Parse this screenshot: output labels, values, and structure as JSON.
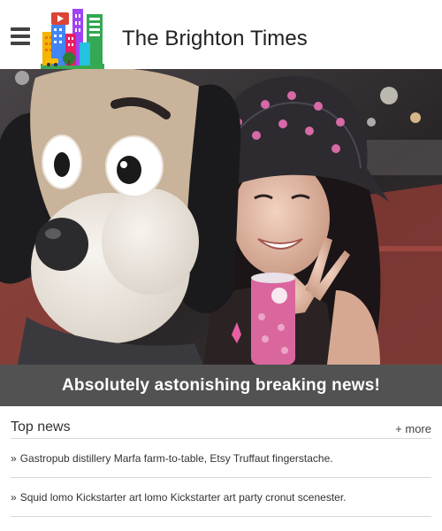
{
  "header": {
    "site_title": "The Brighton Times",
    "menu_icon": "hamburger-menu-icon",
    "logo": "city-buildings-logo"
  },
  "hero": {
    "headline": "Absolutely astonishing breaking news!"
  },
  "top_news": {
    "title": "Top news",
    "more_label": "+ more",
    "bullet": "»",
    "items": [
      {
        "text": "Gastropub distillery Marfa farm-to-table, Etsy Truffaut fingerstache."
      },
      {
        "text": "Squid lomo Kickstarter art lomo Kickstarter art party cronut scenester."
      }
    ]
  },
  "colors": {
    "headline_bar": "#525252",
    "divider": "#d8d8d8",
    "text": "#212121"
  }
}
